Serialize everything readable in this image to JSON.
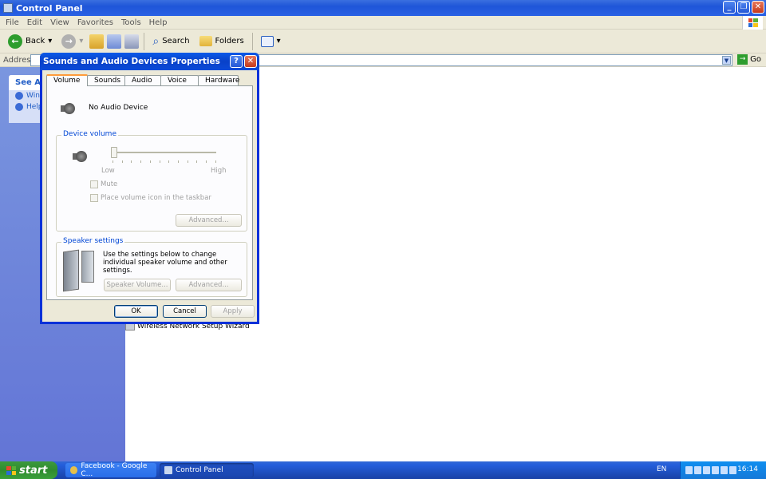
{
  "window": {
    "title": "Control Panel",
    "menu": [
      "File",
      "Edit",
      "View",
      "Favorites",
      "Tools",
      "Help"
    ],
    "toolbar": {
      "back": "Back",
      "search": "Search",
      "folders": "Folders"
    },
    "address": {
      "label": "Address",
      "go": "Go"
    }
  },
  "sidebar": {
    "see_also_header": "See Als",
    "items": [
      "Win",
      "Help"
    ]
  },
  "content": {
    "items": [
      "Wireless Network Setup Wizard"
    ]
  },
  "dialog": {
    "title": "Sounds and Audio Devices Properties",
    "tabs": [
      "Volume",
      "Sounds",
      "Audio",
      "Voice",
      "Hardware"
    ],
    "active_tab": "Volume",
    "device_name": "No Audio Device",
    "device_volume": {
      "legend": "Device volume",
      "low": "Low",
      "high": "High",
      "level": 0,
      "mute": "Mute",
      "place_icon": "Place volume icon in the taskbar",
      "advanced": "Advanced..."
    },
    "speaker_settings": {
      "legend": "Speaker settings",
      "text": "Use the settings below to change individual speaker volume and other settings.",
      "speaker_volume": "Speaker Volume...",
      "advanced": "Advanced..."
    },
    "buttons": {
      "ok": "OK",
      "cancel": "Cancel",
      "apply": "Apply"
    }
  },
  "taskbar": {
    "start": "start",
    "tasks": [
      "Facebook - Google C...",
      "Control Panel"
    ],
    "language": "EN",
    "clock": "16:14"
  },
  "colors": {
    "titlebar": "#0a4ad8",
    "legend_text": "#0046d5",
    "taskbar": "#245edb",
    "start_button": "#2f8b2f",
    "sidebar": "#6f86dc"
  }
}
